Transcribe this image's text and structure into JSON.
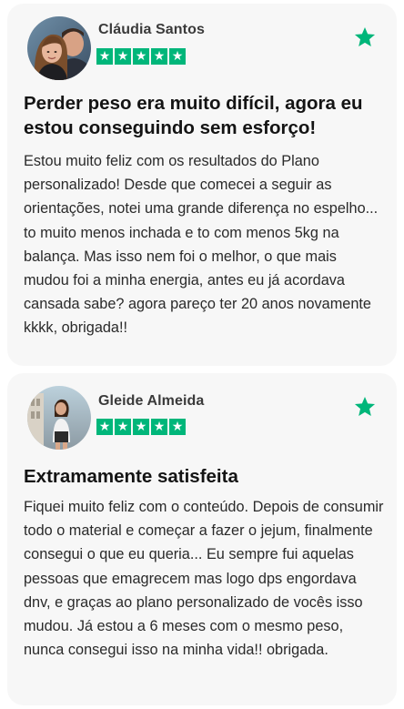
{
  "reviews": [
    {
      "name": "Cláudia Santos",
      "rating": 5,
      "title": "Perder peso era muito difícil, agora eu estou conseguindo sem esforço!",
      "body": "Estou muito feliz com os resultados do Plano personalizado! Desde que comecei a seguir as orientações, notei uma grande diferença no espelho... to muito menos inchada e to com menos 5kg na balança. Mas isso nem foi o melhor, o que mais mudou foi a minha energia, antes eu já acordava cansada sabe? agora pareço ter 20 anos novamente kkkk, obrigada!!"
    },
    {
      "name": "Gleide Almeida",
      "rating": 5,
      "title": "Extramamente satisfeita",
      "body": "Fiquei muito feliz com o conteúdo. Depois de consumir todo o material e começar a fazer o jejum, finalmente consegui o que eu queria... Eu sempre fui aquelas pessoas que emagrecem mas logo dps engordava dnv, e graças ao plano personalizado de vocês isso mudou. Já estou a 6 meses com o mesmo peso, nunca consegui isso na minha vida!! obrigada."
    }
  ],
  "colors": {
    "star_green": "#00b67a",
    "card_bg": "#f7f7f7"
  },
  "icons": {
    "rating_star": "star-icon",
    "favorite": "favorite-star-icon"
  }
}
